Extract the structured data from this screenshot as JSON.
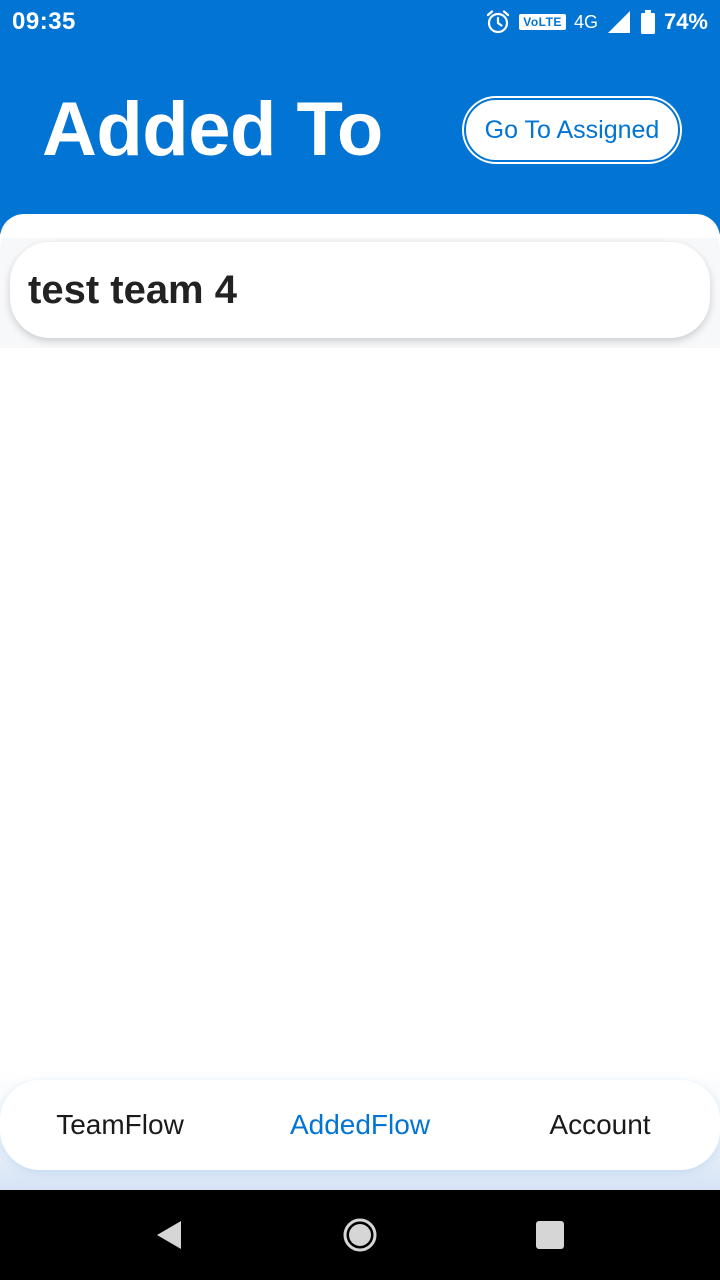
{
  "status_bar": {
    "time": "09:35",
    "volte": "VoLTE",
    "network": "4G",
    "battery": "74%",
    "icons": [
      "alarm-icon",
      "signal-icon",
      "battery-icon"
    ]
  },
  "header": {
    "title": "Added To",
    "go_assigned_label": "Go To Assigned"
  },
  "teams": [
    {
      "name": "test team 4"
    }
  ],
  "bottom_nav": {
    "items": [
      {
        "label": "TeamFlow",
        "active": false
      },
      {
        "label": "AddedFlow",
        "active": true
      },
      {
        "label": "Account",
        "active": false
      }
    ]
  },
  "system_nav": [
    "back-icon",
    "home-icon",
    "recents-icon"
  ],
  "colors": {
    "primary": "#0274d4",
    "text_dark": "#222222",
    "background": "#ffffff"
  }
}
